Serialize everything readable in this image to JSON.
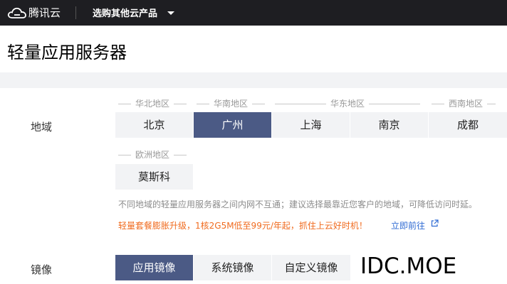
{
  "topbar": {
    "brand": "腾讯云",
    "products_menu": "选购其他云产品",
    "logo_icon": "cloud-icon",
    "caret_icon": "caret-down-icon"
  },
  "page_title": "轻量应用服务器",
  "region": {
    "label": "地域",
    "groups": [
      {
        "name": "华北地区",
        "options": [
          "北京"
        ]
      },
      {
        "name": "华南地区",
        "options": [
          "广州"
        ]
      },
      {
        "name": "华东地区",
        "options": [
          "上海",
          "南京"
        ]
      },
      {
        "name": "西南地区",
        "options": [
          "成都"
        ]
      },
      {
        "name": "欧洲地区",
        "options": [
          "莫斯科"
        ]
      }
    ],
    "selected": "广州",
    "note": "不同地域的轻量应用服务器之间内网不互通；建议选择最靠近您客户的地域，可降低访问时延。",
    "promo": "轻量套餐膨胀升级，1核2G5M低至99元/年起，抓住上云好时机！",
    "promo_link": "立即前往",
    "promo_link_icon": "external-link-icon"
  },
  "image": {
    "label": "镜像",
    "tabs": [
      "应用镜像",
      "系统镜像",
      "自定义镜像"
    ],
    "selected": "应用镜像"
  },
  "watermark": "IDC.MOE",
  "colors": {
    "topbar_bg": "#1e1e22",
    "selected_bg": "#4b5a85",
    "promo": "#f06b1f",
    "link": "#2e6ad3"
  }
}
